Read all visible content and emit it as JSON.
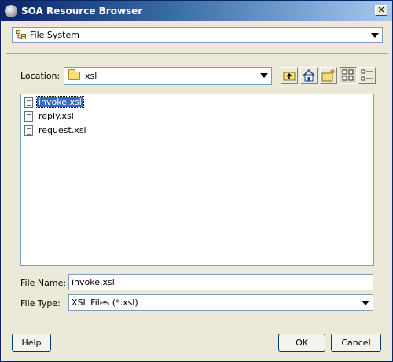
{
  "window": {
    "title": "SOA Resource Browser",
    "close_glyph": "✕"
  },
  "source": {
    "selected": "File System",
    "icon": "file-system-icon"
  },
  "location": {
    "label": "Location:",
    "value": "xsl"
  },
  "toolbar": {
    "buttons": [
      {
        "name": "up-one-level-button",
        "icon": "folder-up-icon"
      },
      {
        "name": "home-button",
        "icon": "home-icon"
      },
      {
        "name": "new-folder-button",
        "icon": "new-folder-icon"
      },
      {
        "name": "list-view-button",
        "icon": "list-view-icon",
        "pressed": true
      },
      {
        "name": "details-view-button",
        "icon": "details-view-icon"
      }
    ]
  },
  "files": [
    {
      "name": "invoke.xsl",
      "selected": true
    },
    {
      "name": "reply.xsl",
      "selected": false
    },
    {
      "name": "request.xsl",
      "selected": false
    }
  ],
  "file_name": {
    "label": "File Name:",
    "value": "invoke.xsl"
  },
  "file_type": {
    "label": "File Type:",
    "value": "XSL Files (*.xsl)"
  },
  "buttons": {
    "help": "Help",
    "ok": "OK",
    "cancel": "Cancel"
  },
  "colors": {
    "titlebar_start": "#0a246a",
    "titlebar_end": "#a6caf0",
    "selection": "#316ac5",
    "dialog_bg": "#ece9d8"
  }
}
